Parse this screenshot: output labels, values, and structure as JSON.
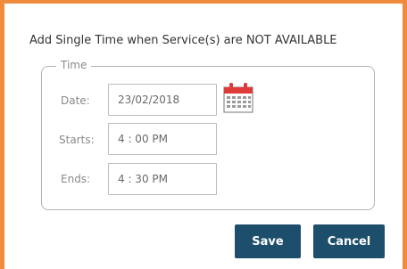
{
  "dialog": {
    "title": "Add Single Time when Service(s) are NOT AVAILABLE"
  },
  "time_group": {
    "legend": "Time",
    "date": {
      "label": "Date:",
      "value": "23/02/2018"
    },
    "starts": {
      "label": "Starts:",
      "value": "4 : 00 PM"
    },
    "ends": {
      "label": "Ends:",
      "value": "4 : 30 PM"
    }
  },
  "calendar_icon": "calendar-icon",
  "actions": {
    "save_label": "Save",
    "cancel_label": "Cancel"
  },
  "colors": {
    "frame": "#f08a3c",
    "button": "#1d4e6b",
    "calendar_top": "#e03b3b"
  }
}
